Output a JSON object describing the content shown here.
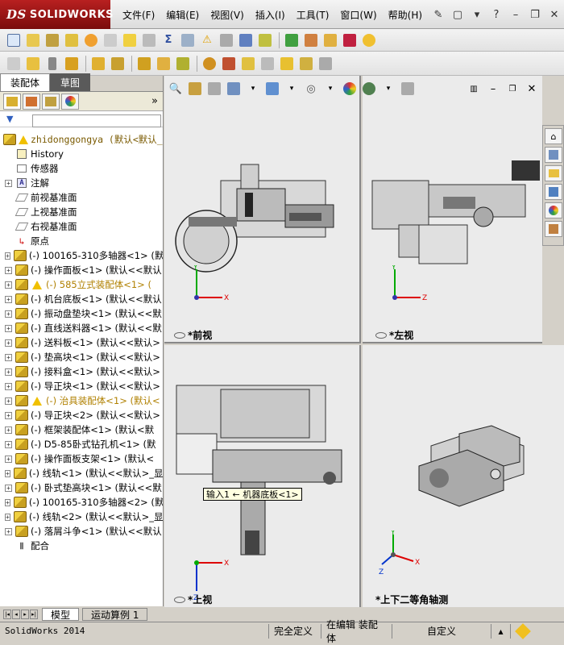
{
  "app": {
    "logo_prefix": "DS",
    "logo_text": "SOLIDWORKS"
  },
  "menu": [
    "文件(F)",
    "编辑(E)",
    "视图(V)",
    "插入(I)",
    "工具(T)",
    "窗口(W)",
    "帮助(H)"
  ],
  "panel_tabs": [
    "装配体",
    "草图"
  ],
  "tree": {
    "root": "zhidonggongya  (默认<默认_显",
    "items": [
      {
        "label": "History",
        "kind": "history",
        "expand": false
      },
      {
        "label": "传感器",
        "kind": "sensor",
        "expand": false
      },
      {
        "label": "注解",
        "kind": "annot",
        "expand": true
      },
      {
        "label": "前视基准面",
        "kind": "plane",
        "expand": false
      },
      {
        "label": "上视基准面",
        "kind": "plane",
        "expand": false
      },
      {
        "label": "右视基准面",
        "kind": "plane",
        "expand": false
      },
      {
        "label": "原点",
        "kind": "origin",
        "expand": false
      },
      {
        "label": "(-) 100165-310多轴器<1> (默",
        "kind": "assy",
        "expand": true
      },
      {
        "label": "(-) 操作面板<1> (默认<<默认",
        "kind": "assy",
        "expand": true
      },
      {
        "label": "(-) 585立式装配体<1> (",
        "kind": "warn",
        "expand": true
      },
      {
        "label": "(-) 机台底板<1> (默认<<默认",
        "kind": "assy",
        "expand": true
      },
      {
        "label": "(-) 振动盘垫块<1> (默认<<默",
        "kind": "assy",
        "expand": true
      },
      {
        "label": "(-) 直线送料器<1> (默认<<默",
        "kind": "assy",
        "expand": true
      },
      {
        "label": "(-) 送料板<1> (默认<<默认>",
        "kind": "assy",
        "expand": true
      },
      {
        "label": "(-) 垫高块<1> (默认<<默认>",
        "kind": "assy",
        "expand": true
      },
      {
        "label": "(-) 接料盒<1> (默认<<默认>",
        "kind": "assy",
        "expand": true
      },
      {
        "label": "(-) 导正块<1> (默认<<默认>",
        "kind": "assy",
        "expand": true
      },
      {
        "label": "(-) 治具装配体<1> (默认<",
        "kind": "warn",
        "expand": true
      },
      {
        "label": "(-) 导正块<2> (默认<<默认>",
        "kind": "assy",
        "expand": true
      },
      {
        "label": "(-) 框架装配体<1> (默认<默",
        "kind": "assy",
        "expand": true
      },
      {
        "label": "(-) D5-85卧式钻孔机<1> (默",
        "kind": "assy",
        "expand": true
      },
      {
        "label": "(-) 操作面板支架<1> (默认<",
        "kind": "assy",
        "expand": true
      },
      {
        "label": "(-) 线轨<1> (默认<<默认>_显",
        "kind": "assy",
        "expand": true
      },
      {
        "label": "(-) 卧式垫高块<1> (默认<<默",
        "kind": "assy",
        "expand": true
      },
      {
        "label": "(-) 100165-310多轴器<2> (默",
        "kind": "assy",
        "expand": true
      },
      {
        "label": "(-) 线轨<2> (默认<<默认>_显",
        "kind": "assy",
        "expand": true
      },
      {
        "label": "(-) 落屑斗争<1> (默认<<默认",
        "kind": "assy",
        "expand": true
      },
      {
        "label": "配合",
        "kind": "mate",
        "expand": false
      }
    ]
  },
  "views": {
    "front": "*前视",
    "left": "*左视",
    "top": "*上视",
    "iso": "*上下二等角轴测"
  },
  "tooltip": "输入1 ← 机器底板<1>",
  "bottom_tabs": [
    "模型",
    "运动算例 1"
  ],
  "status": {
    "app": "SolidWorks 2014",
    "s1": "完全定义",
    "s2": "在编辑 装配体",
    "s3": "自定义"
  },
  "axis": {
    "x": "X",
    "y": "Y",
    "z": "Z"
  }
}
